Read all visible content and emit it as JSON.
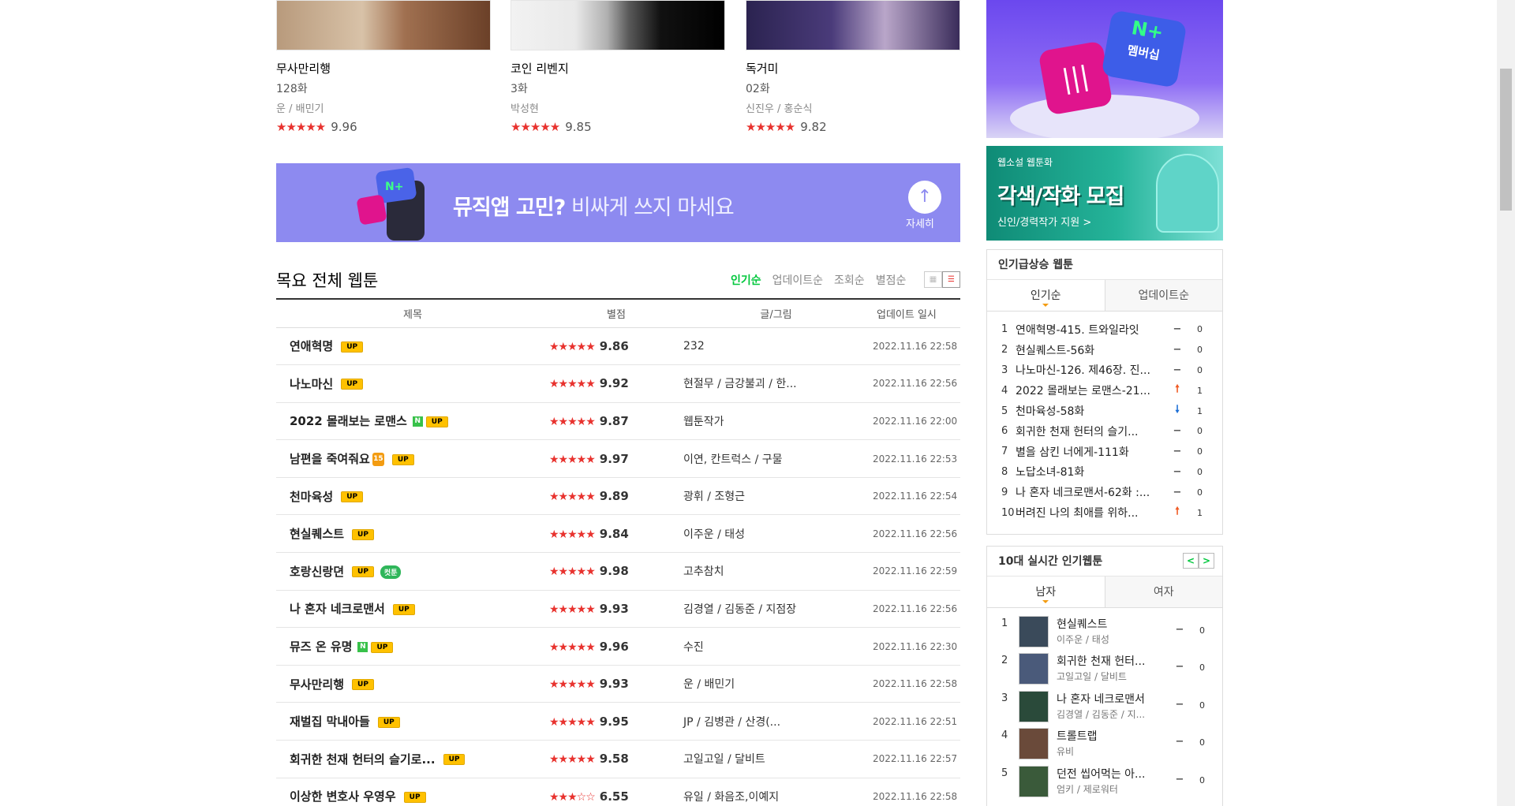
{
  "cards": [
    {
      "title": "무사만리행",
      "episode": "128화",
      "author": "운 / 배민기",
      "stars": "★★★★★",
      "score": "9.96"
    },
    {
      "title": "코인 리벤지",
      "episode": "3화",
      "author": "박성현",
      "stars": "★★★★★",
      "score": "9.85"
    },
    {
      "title": "독거미",
      "episode": "02화",
      "author": "신진우 / 홍순식",
      "stars": "★★★★★",
      "score": "9.82"
    }
  ],
  "banner": {
    "bold_text": "뮤직앱 고민?",
    "light_text": " 비싸게 쓰지 마세요",
    "more_label": "자세히",
    "more_icon": "↑",
    "colors": {
      "background": "#8d8af0"
    }
  },
  "list": {
    "title": "목요 전체 웹툰",
    "sort_tabs": [
      "인기순",
      "업데이트순",
      "조회순",
      "별점순"
    ],
    "active_sort": "인기순",
    "headers": {
      "title": "제목",
      "rating": "별점",
      "author": "글/그림",
      "date": "업데이트 일시"
    },
    "rows": [
      {
        "title": "연애혁명",
        "badges": [
          "up"
        ],
        "stars": "★★★★★",
        "score": "9.86",
        "author": "232",
        "date": "2022.11.16 22:58"
      },
      {
        "title": "나노마신",
        "badges": [
          "up"
        ],
        "stars": "★★★★★",
        "score": "9.92",
        "author": "현절무 / 금강불괴 / 한...",
        "date": "2022.11.16 22:56"
      },
      {
        "title": "2022 몰래보는 로맨스",
        "badges": [
          "n",
          "up"
        ],
        "stars": "★★★★★",
        "score": "9.87",
        "author": "웹툰작가",
        "date": "2022.11.16 22:00"
      },
      {
        "title": "남편을 죽여줘요",
        "badges": [
          "age",
          "up"
        ],
        "stars": "★★★★★",
        "score": "9.97",
        "author": "이연, 칸트럭스 / 구물",
        "date": "2022.11.16 22:53"
      },
      {
        "title": "천마육성",
        "badges": [
          "up"
        ],
        "stars": "★★★★★",
        "score": "9.89",
        "author": "광휘 / 조형근",
        "date": "2022.11.16 22:54"
      },
      {
        "title": "현실퀘스트",
        "badges": [
          "up"
        ],
        "stars": "★★★★★",
        "score": "9.84",
        "author": "이주운 / 태성",
        "date": "2022.11.16 22:56"
      },
      {
        "title": "호랑신랑뎐",
        "badges": [
          "up",
          "cut"
        ],
        "stars": "★★★★★",
        "score": "9.98",
        "author": "고추참치",
        "date": "2022.11.16 22:59"
      },
      {
        "title": "나 혼자 네크로맨서",
        "badges": [
          "up"
        ],
        "stars": "★★★★★",
        "score": "9.93",
        "author": "김경열 / 김동준 / 지점장",
        "date": "2022.11.16 22:56"
      },
      {
        "title": "뮤즈 온 유명",
        "badges": [
          "n",
          "up"
        ],
        "stars": "★★★★★",
        "score": "9.96",
        "author": "수진",
        "date": "2022.11.16 22:30"
      },
      {
        "title": "무사만리행",
        "badges": [
          "up"
        ],
        "stars": "★★★★★",
        "score": "9.93",
        "author": "운 / 배민기",
        "date": "2022.11.16 22:58"
      },
      {
        "title": "재벌집 막내아들",
        "badges": [
          "up"
        ],
        "stars": "★★★★★",
        "score": "9.95",
        "author": "JP / 김병관 / 산경(...",
        "date": "2022.11.16 22:51"
      },
      {
        "title": "회귀한 천재 헌터의 슬기로...",
        "badges": [
          "up"
        ],
        "stars": "★★★★★",
        "score": "9.58",
        "author": "고일고일 / 달비트",
        "date": "2022.11.16 22:57"
      },
      {
        "title": "이상한 변호사 우영우",
        "badges": [
          "up"
        ],
        "stars": "★★★☆☆",
        "score": "6.55",
        "author": "유일 / 화음조,이예지",
        "date": "2022.11.16 22:58"
      }
    ],
    "badge_labels": {
      "up": "UP",
      "n": "N",
      "age": "15",
      "cut": "컷툰"
    }
  },
  "right": {
    "ad1": {
      "brand": "N+",
      "label": "멤버십",
      "icon": "|||"
    },
    "ad2": {
      "line1": "웹소설 웹툰화",
      "line2": "각색/작화 모집",
      "line3": "신인/경력작가 지원 >"
    },
    "rising": {
      "title": "인기급상승 웹툰",
      "tabs": [
        "인기순",
        "업데이트순"
      ],
      "items": [
        {
          "num": "1",
          "name": "연애혁명-415. 트와일라잇",
          "trend": "same",
          "count": "0"
        },
        {
          "num": "2",
          "name": "현실퀘스트-56화",
          "trend": "same",
          "count": "0"
        },
        {
          "num": "3",
          "name": "나노마신-126. 제46장. 진...",
          "trend": "same",
          "count": "0"
        },
        {
          "num": "4",
          "name": "2022 몰래보는 로맨스-21...",
          "trend": "up",
          "count": "1"
        },
        {
          "num": "5",
          "name": "천마육성-58화",
          "trend": "down",
          "count": "1"
        },
        {
          "num": "6",
          "name": "회귀한 천재 헌터의 슬기...",
          "trend": "same",
          "count": "0"
        },
        {
          "num": "7",
          "name": "별을 삼킨 너에게-111화",
          "trend": "same",
          "count": "0"
        },
        {
          "num": "8",
          "name": "노답소녀-81화",
          "trend": "same",
          "count": "0"
        },
        {
          "num": "9",
          "name": "나 혼자 네크로맨서-62화 :...",
          "trend": "same",
          "count": "0"
        },
        {
          "num": "10",
          "name": "버려진 나의 최애를 위하...",
          "trend": "up",
          "count": "1"
        }
      ]
    },
    "realtime": {
      "title": "10대 실시간 인기웹툰",
      "tabs": [
        "남자",
        "여자"
      ],
      "prev": "<",
      "next": ">",
      "items": [
        {
          "num": "1",
          "name": "현실퀘스트",
          "author": "이주운 / 태성",
          "trend": "−",
          "count": "0"
        },
        {
          "num": "2",
          "name": "회귀한 천재 헌터...",
          "author": "고일고일 / 달비트",
          "trend": "−",
          "count": "0"
        },
        {
          "num": "3",
          "name": "나 혼자 네크로맨서",
          "author": "김경열 / 김동준 / 지...",
          "trend": "−",
          "count": "0"
        },
        {
          "num": "4",
          "name": "트롤트랩",
          "author": "유비",
          "trend": "−",
          "count": "0"
        },
        {
          "num": "5",
          "name": "던전 씹어먹는 아...",
          "author": "엄키 / 제로워터",
          "trend": "−",
          "count": "0"
        }
      ]
    }
  },
  "trend_symbols": {
    "up": "🠕",
    "down": "🠗",
    "same": "−"
  }
}
